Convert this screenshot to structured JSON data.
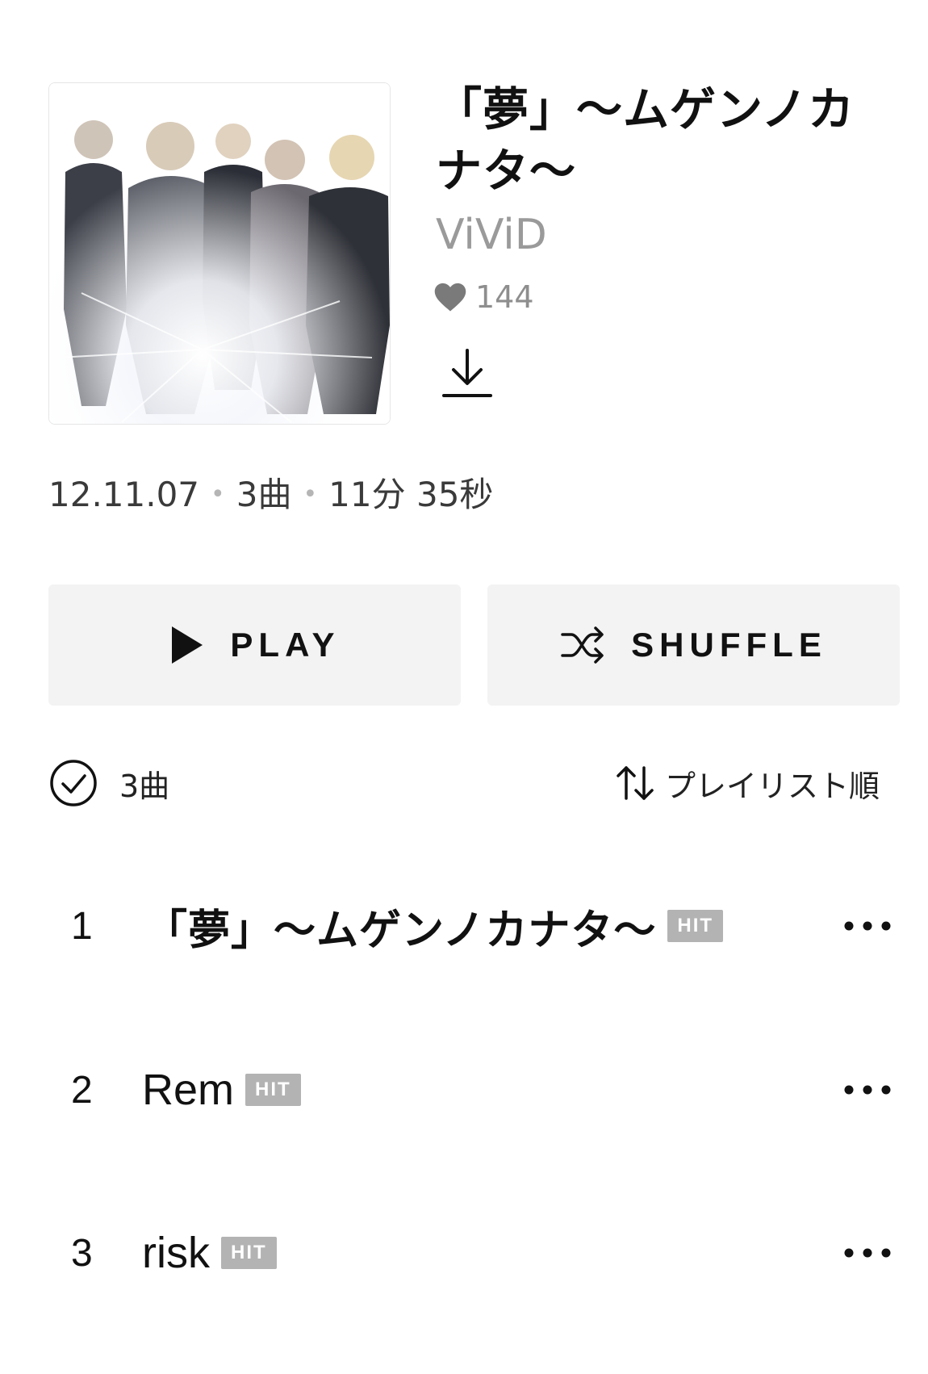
{
  "album": {
    "title": "「夢」〜ムゲンノカナタ〜",
    "artist": "ViViD",
    "likes": "144",
    "release_date": "12.11.07",
    "track_count": "3曲",
    "duration": "11分 35秒",
    "meta_separator": "•",
    "art_icon": "album-cover-image"
  },
  "actions": {
    "play_label": "PLAY",
    "shuffle_label": "SHUFFLE"
  },
  "list_header": {
    "count_label": "3曲",
    "sort_label": "プレイリスト順"
  },
  "tracks": [
    {
      "number": "1",
      "title": "「夢」〜ムゲンノカナタ〜",
      "badge": "HIT"
    },
    {
      "number": "2",
      "title": "Rem",
      "badge": "HIT"
    },
    {
      "number": "3",
      "title": "risk",
      "badge": "HIT"
    }
  ],
  "colors": {
    "text": "#111111",
    "secondary_text": "#9a9a9a",
    "button_bg": "#f3f3f3",
    "badge_bg": "#b3b3b3"
  }
}
